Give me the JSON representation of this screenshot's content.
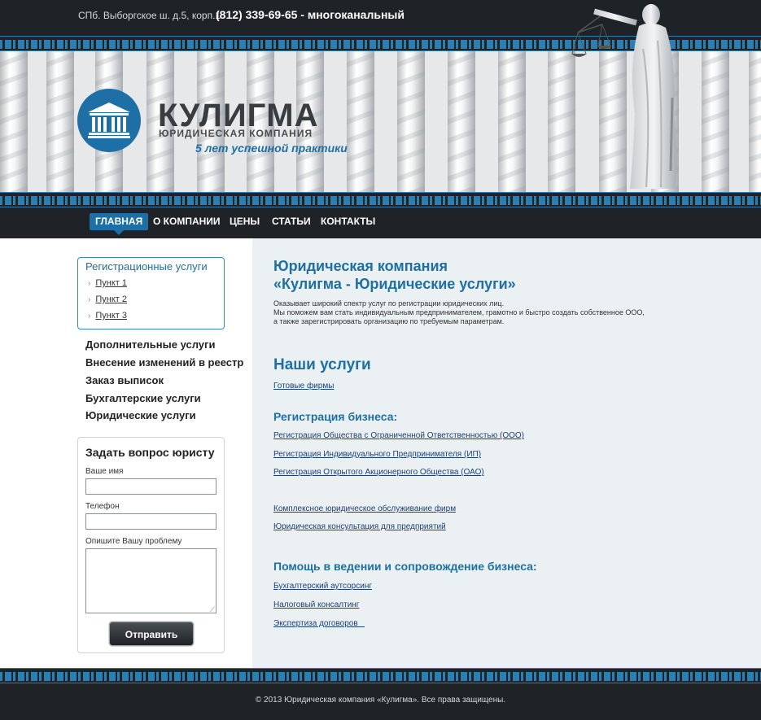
{
  "header": {
    "address": "СПб. Выборгское ш. д.5, корп.1",
    "phone": "(812) 339-69-65 - многоканальный",
    "brand_name": "КУЛИГМА",
    "brand_subtitle": "ЮРИДИЧЕСКАЯ КОМПАНИЯ",
    "slogan": "5 лет успешной практики"
  },
  "nav": {
    "items": [
      {
        "label": "ГЛАВНАЯ",
        "active": true
      },
      {
        "label": "О КОМПАНИИ"
      },
      {
        "label": "ЦЕНЫ"
      },
      {
        "label": "СТАТЬИ"
      },
      {
        "label": "КОНТАКТЫ"
      }
    ]
  },
  "sidebar": {
    "reg_title": "Регистрационные услуги",
    "sub_items": [
      "Пункт 1",
      "Пункт 2",
      "Пункт 3"
    ],
    "links": [
      "Дополнительные услуги",
      "Внесение изменений в реестр",
      "Заказ выписок",
      "Бухгалтерские услуги",
      "Юридические услуги"
    ]
  },
  "form": {
    "title": "Задать вопрос юристу",
    "name_label": "Ваше имя",
    "phone_label": "Телефон",
    "problem_label": "Опишите Вашу проблему",
    "submit_label": "Отправить"
  },
  "main": {
    "title_line1": "Юридическая компания",
    "title_line2": "«Кулигма - Юридические услуги»",
    "intro_lines": [
      "Оказывает широкий спектр услуг по регистрации юридических лиц.",
      "Мы поможем вам стать индивидуальным предпринимателем, грамотно и быстро создать собственное ООО,",
      "а также зарегистрировать организацию по требуемым параметрам."
    ],
    "services_title": "Наши услуги",
    "ready_firms": "Готовые фирмы",
    "reg_business_title": "Регистрация бизнеса:",
    "reg_links": [
      "Регистрация Общества с Ограниченной Ответственностью (ООО)",
      "Регистрация Индивидуального Предпринимателя (ИП)",
      "Регистрация Открытого Акционерного Общества (ОАО)"
    ],
    "service_links": [
      "Комплексное юридическое обслуживание фирм",
      "Юридическая консультация для предприятий"
    ],
    "help_title": "Помощь в ведении  и сопровождение бизнеса:",
    "help_links": [
      "Бухгалтерский аутсорсинг",
      "Налоговый консалтинг",
      "Экспертиза договоров   "
    ]
  },
  "footer": {
    "copyright": "© 2013 Юридическая компания «Кулигма». Все права защищены."
  },
  "colors": {
    "accent": "#1e6fa4",
    "dark": "#1f2327",
    "content_bg": "#ebf0f3"
  }
}
